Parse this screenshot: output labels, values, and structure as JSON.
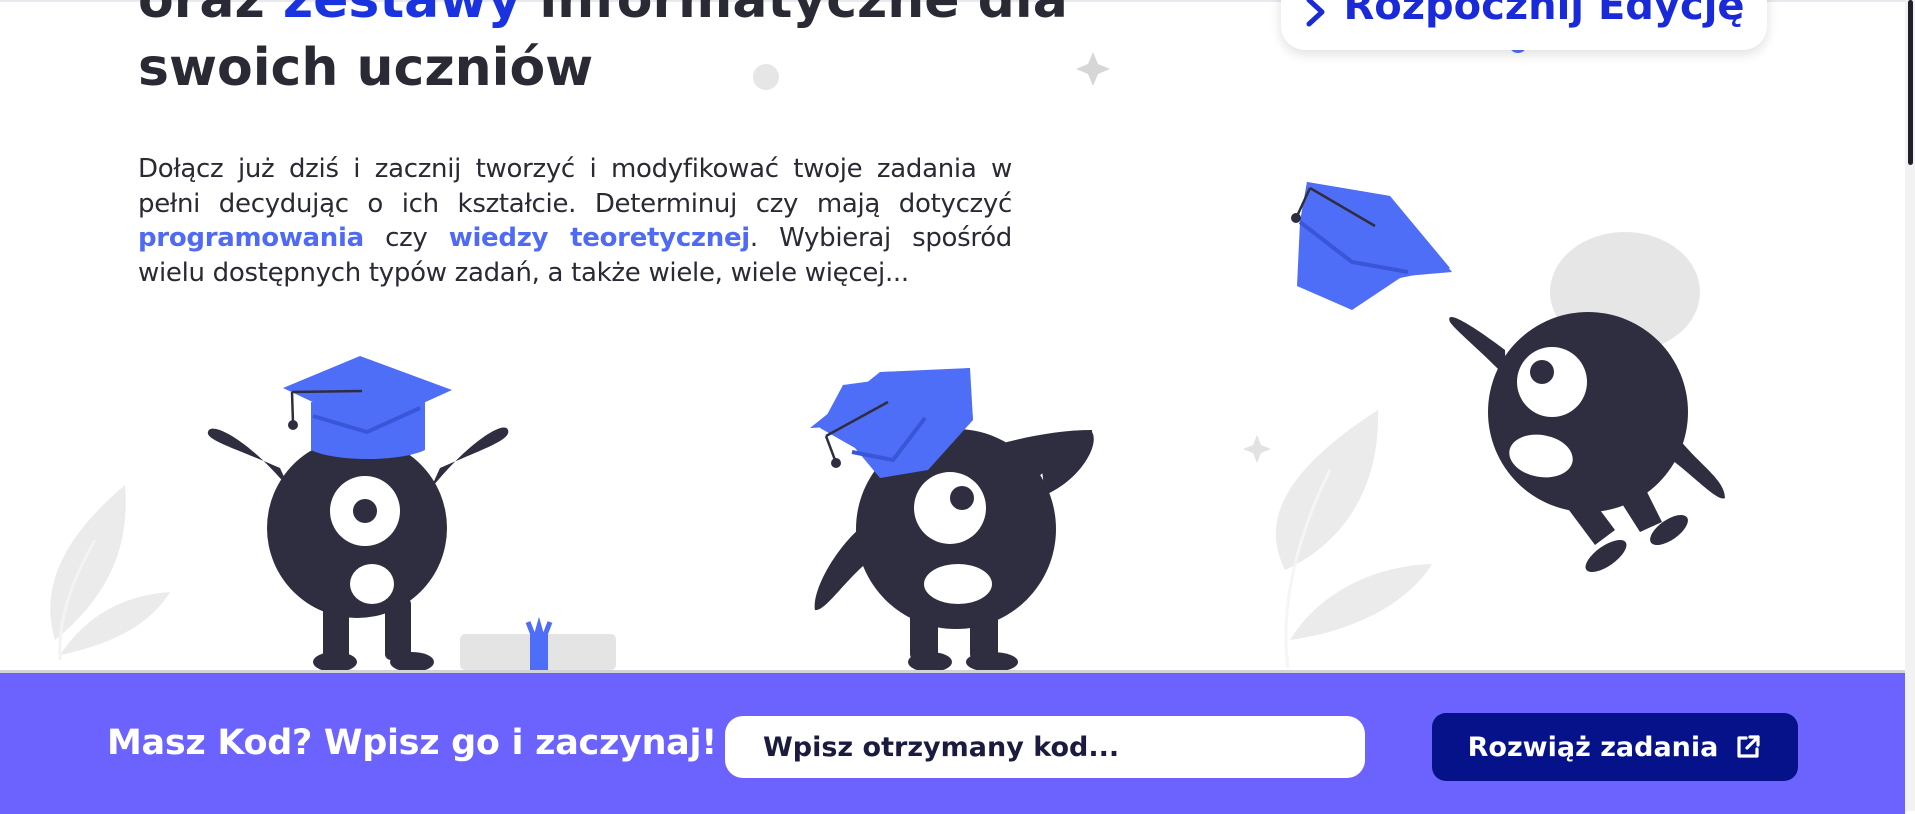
{
  "hero": {
    "headline_pre": "oraz",
    "headline_accent": "zestawy",
    "headline_post": "informatyczne dla",
    "headline_line2": "swoich uczniów",
    "intro_part1": "Dołącz już dziś i zacznij tworzyć i modyfikować twoje zadania w pełni decydując o ich kształcie. Determinuj czy mają dotyczyć",
    "intro_hl1": "programowania",
    "intro_mid": "czy",
    "intro_hl2": "wiedzy teoretycznej",
    "intro_part2": ". Wybieraj spośród wielu dostępnych typów zadań, a także wiele, wiele więcej..."
  },
  "start_edit": {
    "label": "Rozpocznij Edycję",
    "icon": "chevron-right-icon"
  },
  "code_bar": {
    "title": "Masz Kod? Wpisz go i zaczynaj!",
    "input_placeholder": "Wpisz otrzymany kod...",
    "button_label": "Rozwiąż zadania",
    "button_icon": "external-link-icon"
  },
  "colors": {
    "accent": "#1a33e0",
    "highlight": "#4f6bf5",
    "cap_blue": "#4f6ef7",
    "monster": "#2f2e41",
    "code_bar_bg": "#6c63ff",
    "button_bg": "#05128a"
  }
}
